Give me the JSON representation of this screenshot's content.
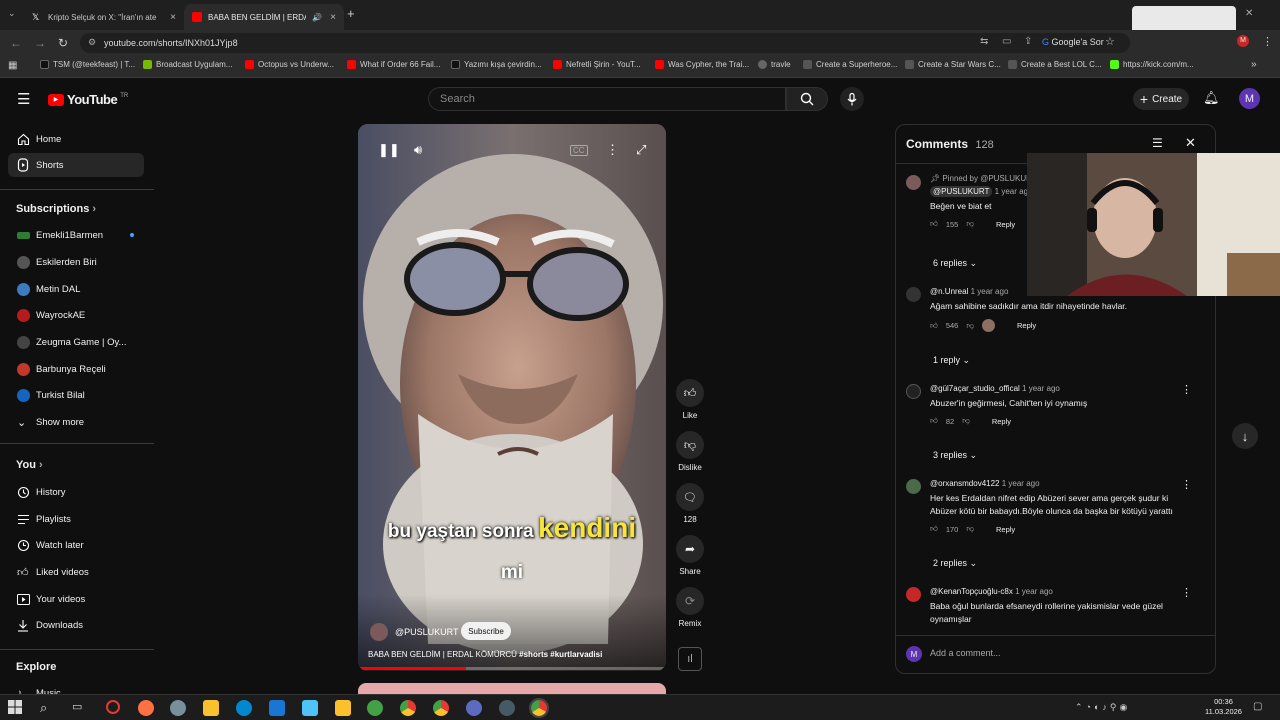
{
  "browser": {
    "tabs": [
      {
        "label": "Kripto Selçuk on X: \"İran'ın ate",
        "active": false
      },
      {
        "label": "BABA BEN GELDİM | ERDAL",
        "active": true
      }
    ],
    "url": "youtube.com/shorts/INXh01JYjp8",
    "google_label": "Google'a Sor",
    "bookmarks": [
      {
        "label": "TSM (@teekfeast) | T...",
        "color": "#111"
      },
      {
        "label": "Broadcast Uygulam...",
        "color": "#76b900"
      },
      {
        "label": "Octopus vs Underw...",
        "color": "#ff0000"
      },
      {
        "label": "What if Order 66 Fail...",
        "color": "#ff0000"
      },
      {
        "label": "Yazımı kışa çevirdin...",
        "color": "#111"
      },
      {
        "label": "Nefretli Şirin - YouT...",
        "color": "#ff0000"
      },
      {
        "label": "Was Cypher, the Trai...",
        "color": "#ff0000"
      },
      {
        "label": "travle",
        "color": "#666"
      },
      {
        "label": "Create a Superheroe...",
        "color": "#555"
      },
      {
        "label": "Create a Star Wars C...",
        "color": "#555"
      },
      {
        "label": "Create a Best LOL C...",
        "color": "#555"
      },
      {
        "label": "https://kick.com/m...",
        "color": "#53fc18"
      }
    ]
  },
  "header": {
    "logo_text": "YouTube",
    "logo_sup": "TR",
    "search_placeholder": "Search",
    "create_label": "Create",
    "avatar_letter": "M"
  },
  "sidebar": {
    "main": [
      {
        "label": "Home",
        "icon": "home-icon"
      },
      {
        "label": "Shorts",
        "icon": "shorts-icon",
        "active": true
      }
    ],
    "subscriptions_title": "Subscriptions",
    "subscriptions": [
      {
        "label": "Emekli1Barmen",
        "color": "#2e7d32",
        "live": true
      },
      {
        "label": "Eskilerden Biri",
        "color": "#555"
      },
      {
        "label": "Metin DAL",
        "color": "#3b7bbf"
      },
      {
        "label": "WayrockAE",
        "color": "#b71c1c"
      },
      {
        "label": "Zeugma Game | Oy...",
        "color": "#444"
      },
      {
        "label": "Barbunya Reçeli",
        "color": "#c0392b"
      },
      {
        "label": "Turkist Bilal",
        "color": "#1565c0"
      }
    ],
    "show_more": "Show more",
    "you_title": "You",
    "you_items": [
      {
        "label": "History",
        "icon": "history-icon"
      },
      {
        "label": "Playlists",
        "icon": "playlists-icon"
      },
      {
        "label": "Watch later",
        "icon": "watch-later-icon"
      },
      {
        "label": "Liked videos",
        "icon": "liked-videos-icon"
      },
      {
        "label": "Your videos",
        "icon": "your-videos-icon"
      },
      {
        "label": "Downloads",
        "icon": "downloads-icon"
      }
    ],
    "explore_title": "Explore",
    "explore_first": "Music"
  },
  "video": {
    "caption_line1_a": "bu yaştan sonra",
    "caption_line1_b": "kendini",
    "caption_line2": "mi",
    "channel": "@PUSLUKURT",
    "subscribe": "Subscribe",
    "title_prefix": "BABA BEN GELDİM | ERDAL KÖMÜRCÜ ",
    "title_tags": "#shorts #kurtlarvadisi",
    "progress": 0.35
  },
  "actions": {
    "like": "Like",
    "dislike": "Dislike",
    "comments_count": "128",
    "share": "Share",
    "remix": "Remix"
  },
  "comments": {
    "title": "Comments",
    "count": "128",
    "add_placeholder": "Add a comment...",
    "user_letter": "M",
    "items": [
      {
        "pinned": "Pinned by @PUSLUKURT",
        "author": "@PUSLUKURT",
        "time": "1 year ago",
        "text": "Beğen ve biat et",
        "likes": "155",
        "replies": "6 replies",
        "color": "#7a5a5a"
      },
      {
        "author": "@n.Unreal",
        "time": "1 year ago",
        "text": "Ağam sahibine sadıkdır ama itdir nihayetinde havlar.",
        "likes": "546",
        "replies": "1 reply",
        "color": "#333"
      },
      {
        "author": "@gül7açar_studio_offical",
        "time": "1 year ago",
        "text": "Abuzer'in geğirmesi, Cahit'ten iyi oynamış",
        "likes": "82",
        "replies": "3 replies",
        "color": "#222"
      },
      {
        "author": "@orxansmdov4122",
        "time": "1 year ago",
        "text": "Her kes Erdaldan nifret edip Abüzeri sever ama gerçek şudur ki Abüzer kötü bir babaydı.Böyle olunca da başka bir kötüyü yarattı",
        "likes": "170",
        "replies": "2 replies",
        "color": "#4a6a4a"
      },
      {
        "author": "@KenanTopçuoğlu-c8x",
        "time": "1 year ago",
        "text": "Baba oğul bunlarda efsaneydi rollerine yakismislar vede güzel oynamışlar",
        "color": "#c62828"
      }
    ],
    "reply_label": "Reply"
  },
  "taskbar": {
    "time": "00:36",
    "date": "11.03.2026"
  }
}
